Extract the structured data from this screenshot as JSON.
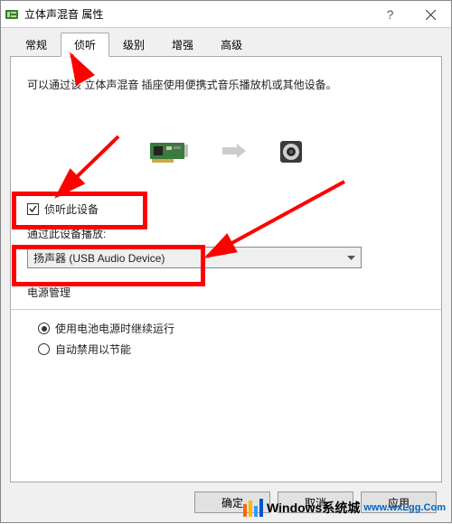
{
  "titlebar": {
    "title": "立体声混音 属性"
  },
  "tabs": {
    "items": [
      {
        "label": "常规"
      },
      {
        "label": "侦听"
      },
      {
        "label": "级别"
      },
      {
        "label": "增强"
      },
      {
        "label": "高级"
      }
    ],
    "activeIndex": 1
  },
  "listen": {
    "description": "可以通过该 立体声混音 插座使用便携式音乐播放机或其他设备。",
    "checkbox_label": "侦听此设备",
    "checkbox_checked": true,
    "playback_label": "通过此设备播放:",
    "dropdown_value": "扬声器 (USB Audio Device)",
    "power_label": "电源管理",
    "radio_continue": "使用电池电源时继续运行",
    "radio_disable": "自动禁用以节能",
    "radio_selected": 0
  },
  "buttons": {
    "ok": "确定",
    "cancel": "取消",
    "apply": "应用"
  },
  "watermark": {
    "text": "Windows系统城",
    "domain": "www.wxLgg.Com"
  }
}
